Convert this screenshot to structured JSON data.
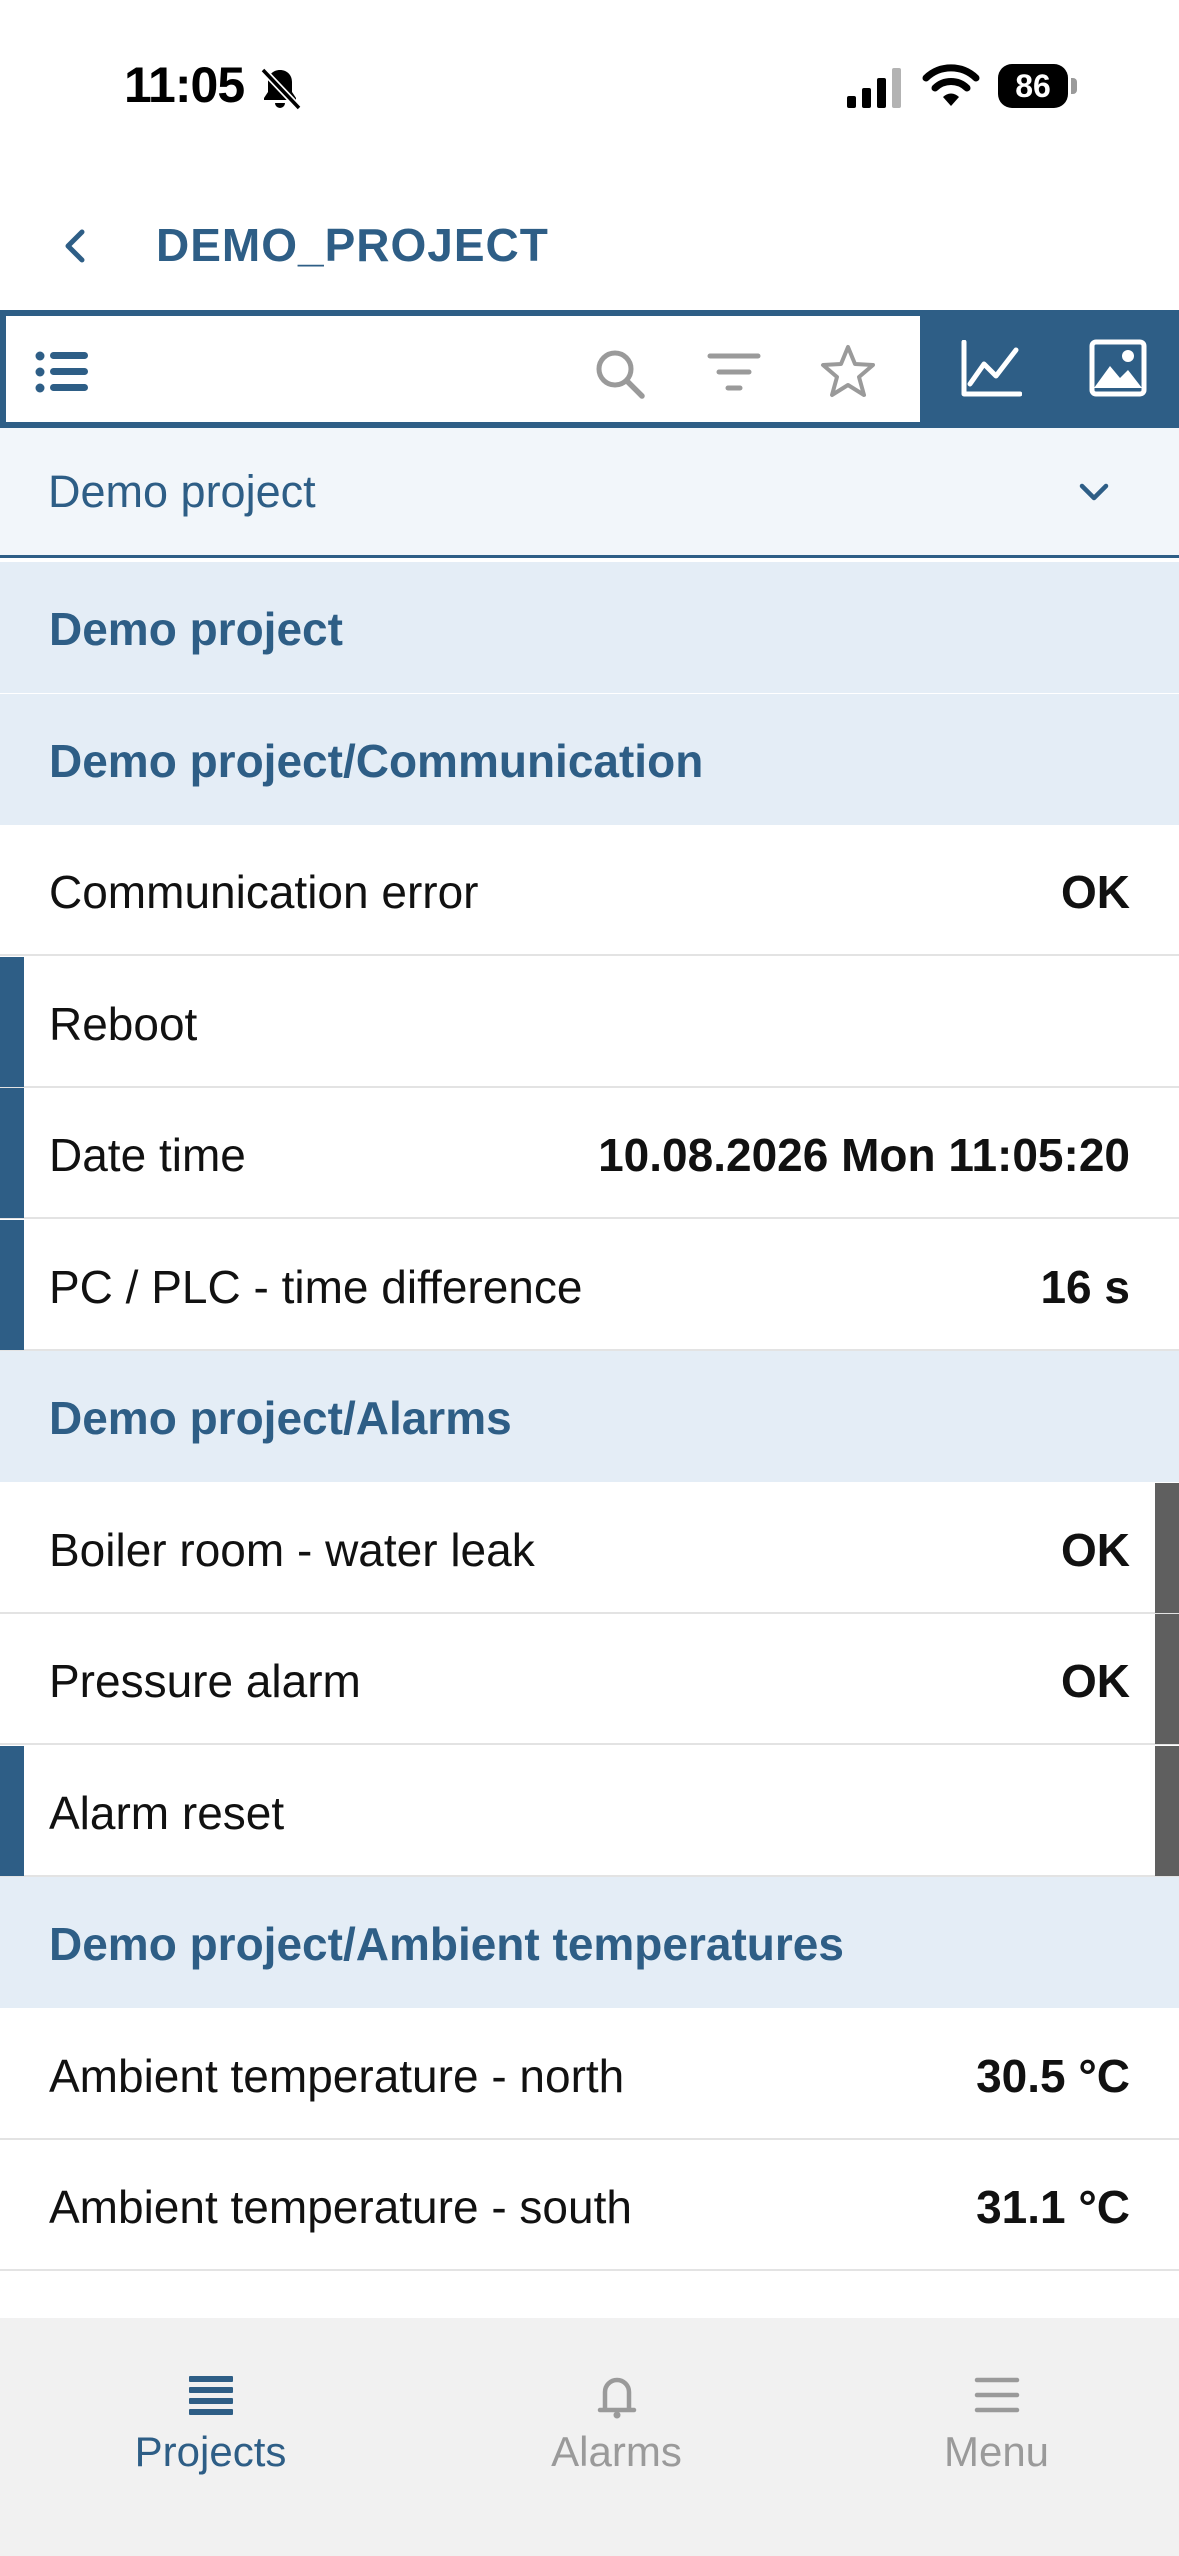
{
  "status_bar": {
    "time": "11:05",
    "battery": "86",
    "icons": [
      "bell-slash-icon",
      "cellular-signal-icon",
      "wifi-icon",
      "battery-icon"
    ]
  },
  "header": {
    "title": "DEMO_PROJECT",
    "back_icon": "chevron-left-icon"
  },
  "toolbar": {
    "icons": [
      "list-icon",
      "search-icon",
      "filter-icon",
      "star-icon",
      "line-chart-icon",
      "image-icon"
    ]
  },
  "selector": {
    "selected": "Demo project",
    "icon": "chevron-down-icon"
  },
  "rows": [
    {
      "kind": "group",
      "label": "Demo project",
      "value": "",
      "left_bar": false,
      "right_bar": false
    },
    {
      "kind": "group",
      "label": "Demo project/Communication",
      "value": "",
      "left_bar": false,
      "right_bar": false
    },
    {
      "kind": "item",
      "label": "Communication error",
      "value": "OK",
      "left_bar": false,
      "right_bar": false
    },
    {
      "kind": "item",
      "label": "Reboot",
      "value": "",
      "left_bar": true,
      "right_bar": false
    },
    {
      "kind": "item",
      "label": "Date time",
      "value": "10.08.2026 Mon 11:05:20",
      "left_bar": true,
      "right_bar": false
    },
    {
      "kind": "item",
      "label": "PC / PLC - time difference",
      "value": "16 s",
      "left_bar": true,
      "right_bar": false
    },
    {
      "kind": "group",
      "label": "Demo project/Alarms",
      "value": "",
      "left_bar": false,
      "right_bar": false
    },
    {
      "kind": "item",
      "label": "Boiler room - water leak",
      "value": "OK",
      "left_bar": false,
      "right_bar": true
    },
    {
      "kind": "item",
      "label": "Pressure alarm",
      "value": "OK",
      "left_bar": false,
      "right_bar": true
    },
    {
      "kind": "item",
      "label": "Alarm reset",
      "value": "",
      "left_bar": true,
      "right_bar": true
    },
    {
      "kind": "group",
      "label": "Demo project/Ambient temperatures",
      "value": "",
      "left_bar": false,
      "right_bar": false
    },
    {
      "kind": "item",
      "label": "Ambient temperature - north",
      "value": "30.5 °C",
      "left_bar": false,
      "right_bar": false
    },
    {
      "kind": "item",
      "label": "Ambient temperature - south",
      "value": "31.1 °C",
      "left_bar": false,
      "right_bar": false
    }
  ],
  "tabs": [
    {
      "label": "Projects",
      "icon": "projects-icon",
      "active": true
    },
    {
      "label": "Alarms",
      "icon": "bell-icon",
      "active": false
    },
    {
      "label": "Menu",
      "icon": "menu-icon",
      "active": false
    }
  ],
  "colors": {
    "accent": "#2e5e86",
    "group_bg": "#e4edf6",
    "selector_bg": "#f2f6fa",
    "alarm_bar": "#5f5f5f",
    "tabbar_bg": "#f1f1f1",
    "inactive": "#9a9a9a"
  }
}
